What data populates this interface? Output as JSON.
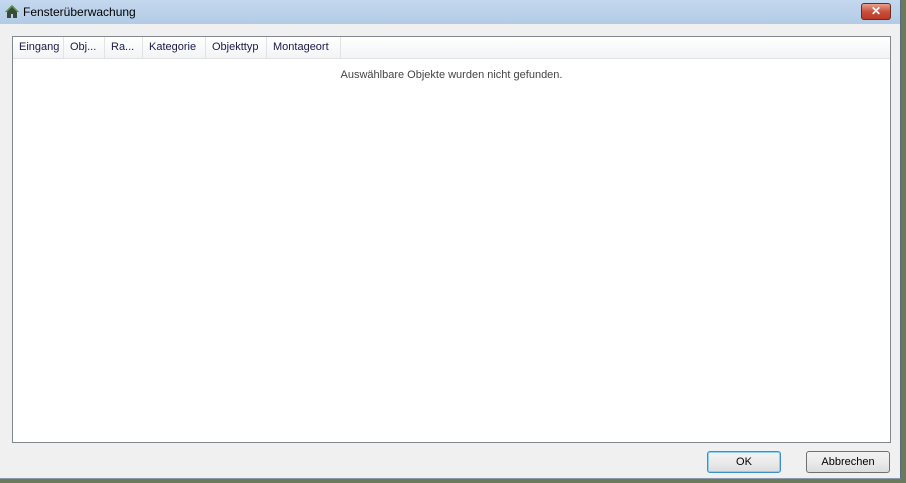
{
  "window": {
    "title": "Fensterüberwachung",
    "icon": "home-icon",
    "close_label": "✕"
  },
  "list": {
    "columns": [
      "Eingang",
      "Obj...",
      "Ra...",
      "Kategorie",
      "Objekttyp",
      "Montageort"
    ],
    "empty_message": "Auswählbare Objekte wurden nicht gefunden."
  },
  "buttons": {
    "ok": "OK",
    "cancel": "Abbrechen"
  }
}
